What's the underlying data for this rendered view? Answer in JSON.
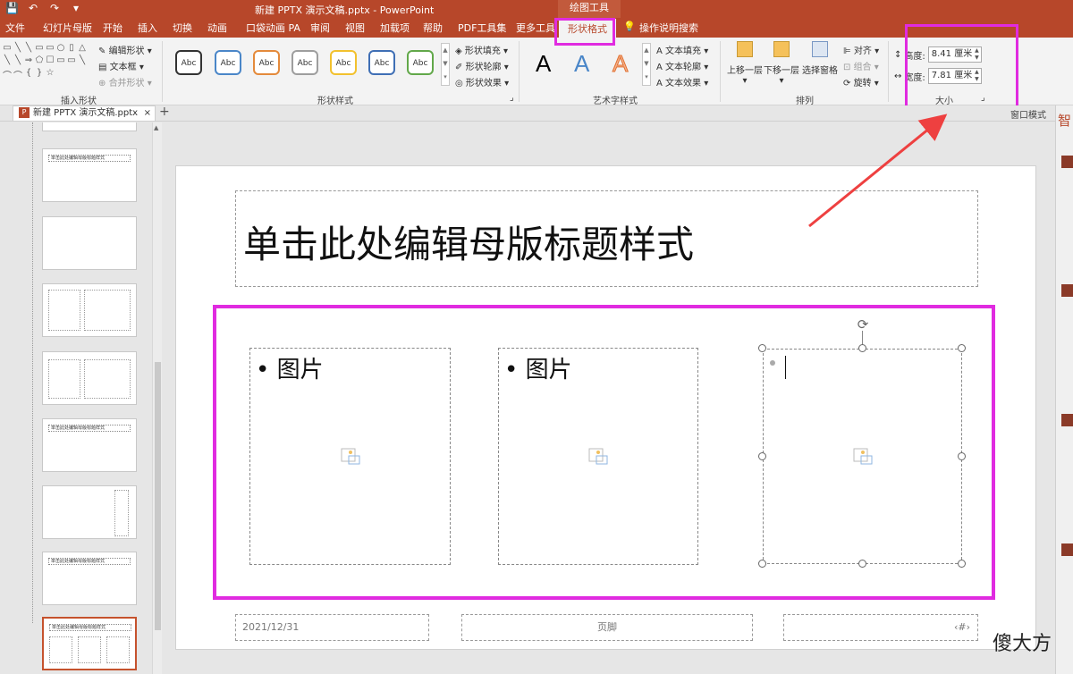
{
  "colors": {
    "accent": "#b7472a",
    "highlight": "#e02be0",
    "arrow": "#ee4040"
  },
  "titlebar": {
    "quick_access_icons": [
      "save-icon",
      "undo-icon",
      "redo-icon",
      "customize-icon"
    ],
    "quick_access_glyphs": [
      "💾",
      "↶",
      "↷",
      "▾"
    ],
    "document_title": "新建 PPTX 演示文稿.pptx  -  PowerPoint",
    "context_tool": "绘图工具"
  },
  "tabs": {
    "file": "文件",
    "slide_master": "幻灯片母版",
    "home": "开始",
    "insert": "插入",
    "transitions": "切换",
    "animations": "动画",
    "pocket_animation": "口袋动画 PA",
    "review": "审阅",
    "view": "视图",
    "addins": "加载项",
    "help": "帮助",
    "pdf_tools": "PDF工具集",
    "more_tools": "更多工具",
    "shape_format": "形状格式",
    "tell_me": "操作说明搜索"
  },
  "ribbon": {
    "insert_shapes": {
      "label": "插入形状",
      "glyphs": [
        "▭",
        "╲",
        "╲",
        "▭",
        "▭",
        "○",
        "▯",
        "△",
        "╲",
        "╲",
        "⇒",
        "⬠",
        "☐",
        "▭",
        "▭",
        "╲",
        "⌒",
        "⌒",
        "{",
        "}",
        "☆"
      ],
      "edit_shape": "编辑形状",
      "text_box": "文本框",
      "merge_shapes": "合并形状"
    },
    "shape_styles": {
      "label": "形状样式",
      "swatch_text": "Abc",
      "swatch_colors": [
        "#333333",
        "#4a86c8",
        "#e48a3b",
        "#9e9e9e",
        "#f2c12e",
        "#3f6fb5",
        "#62a84a"
      ],
      "fill": "形状填充",
      "outline": "形状轮廓",
      "effects": "形状效果"
    },
    "wordart_styles": {
      "label": "艺术字样式",
      "letter": "A",
      "text_fill": "文本填充",
      "text_outline": "文本轮廓",
      "text_effects": "文本效果"
    },
    "arrange": {
      "label": "排列",
      "bring_forward": "上移一层",
      "send_backward": "下移一层",
      "selection_pane": "选择窗格",
      "align": "对齐",
      "group": "组合",
      "rotate": "旋转"
    },
    "size": {
      "label": "大小",
      "height_label": "高度:",
      "height_value": "8.41 厘米",
      "width_label": "宽度:",
      "width_value": "7.81 厘米"
    }
  },
  "doc_tab": {
    "name": "新建 PPTX 演示文稿.pptx",
    "close": "×",
    "new_tab": "+",
    "view_mode": "窗口模式"
  },
  "thumbnails": {
    "title_text": "单击此处编辑母版标题样式"
  },
  "slide": {
    "title": "单击此处编辑母版标题样式",
    "pic_label_1": "• 图片",
    "pic_label_2": "• 图片",
    "footer_date": "2021/12/31",
    "footer_text": "页脚",
    "footer_number": "‹#›"
  },
  "right_pane": {
    "header": "智"
  },
  "watermark": "傻大方"
}
